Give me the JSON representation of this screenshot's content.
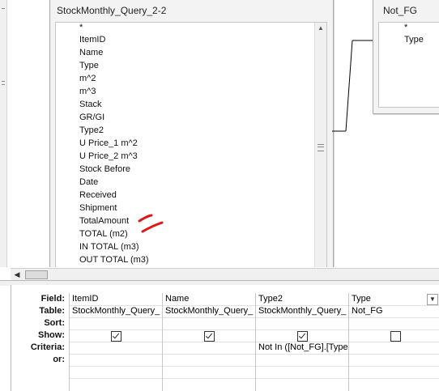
{
  "tables": [
    {
      "title": "StockMonthly_Query_2-2",
      "fields": [
        "*",
        "ItemID",
        "Name",
        "Type",
        "m^2",
        "m^3",
        "Stack",
        "GR/GI",
        "Type2",
        "U Price_1 m^2",
        "U Price_2 m^3",
        "Stock Before",
        "Date",
        "Received",
        "Shipment",
        "TotalAmount",
        "TOTAL (m2)",
        "IN TOTAL (m3)",
        "OUT TOTAL (m3)"
      ]
    },
    {
      "title": "Not_FG",
      "fields": [
        "*",
        "Type"
      ]
    }
  ],
  "grid": {
    "row_labels": [
      "Field:",
      "Table:",
      "Sort:",
      "Show:",
      "Criteria:",
      "or:"
    ],
    "columns": [
      {
        "field": "ItemID",
        "table": "StockMonthly_Query_",
        "sort": "",
        "show": true,
        "criteria": ""
      },
      {
        "field": "Name",
        "table": "StockMonthly_Query_",
        "sort": "",
        "show": true,
        "criteria": ""
      },
      {
        "field": "Type2",
        "table": "StockMonthly_Query_",
        "sort": "",
        "show": true,
        "criteria": "Not In ([Not_FG].[Type"
      },
      {
        "field": "Type",
        "table": "Not_FG",
        "sort": "",
        "show": false,
        "criteria": ""
      }
    ]
  },
  "annotation": {
    "color": "#e0161b",
    "note": "red pen marks"
  },
  "icons": {
    "scroll_up": "▲",
    "scroll_down": "▼",
    "scroll_left": "◀",
    "dropdown": "▼"
  }
}
